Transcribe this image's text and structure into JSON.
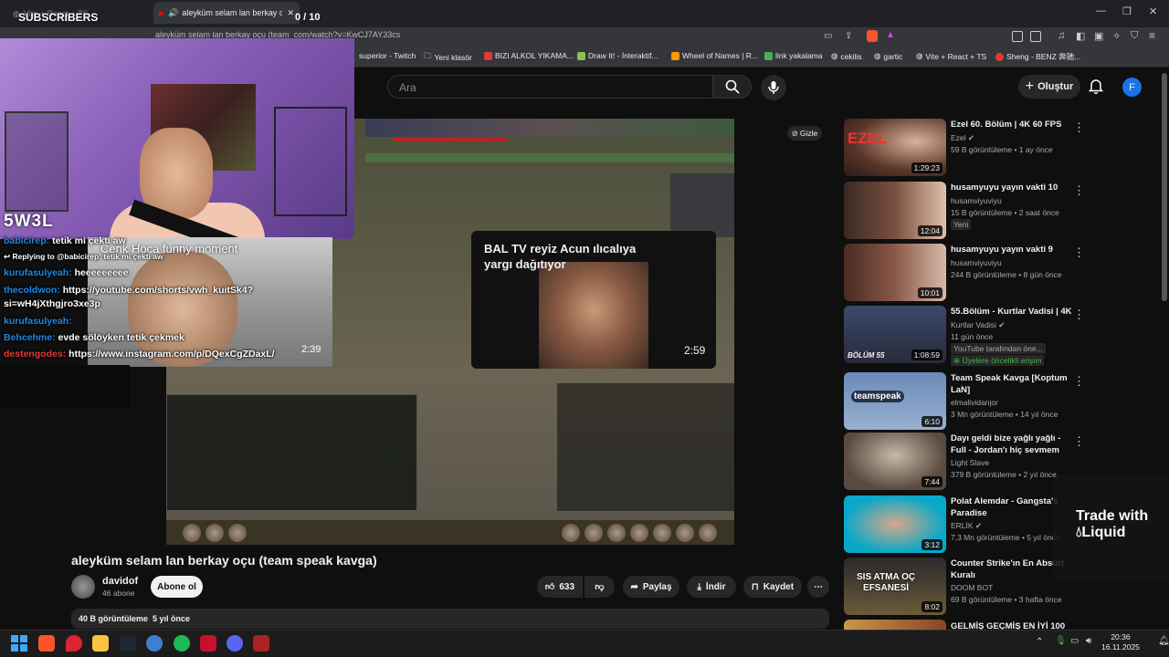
{
  "browser": {
    "tab1_title": "Vite + React + TS",
    "tab2_title": "aleyküm selam lan berkay oçu",
    "url_prefix": "aleyküm selam lan berkay oçu (team",
    "url": "com/watch?v=KwCJ7AY33cs",
    "bookmarks": [
      "superior - Twitch",
      "Yeni klasör",
      "BIZI ALKOL YIKAMA...",
      "Draw It! - İnteraktif...",
      "Wheel of Names | R...",
      "link yakalama",
      "cekilis",
      "gartic",
      "Vite + React + TS",
      "Sheng - BENZ 奔驰..."
    ]
  },
  "youtube": {
    "search_placeholder": "Ara",
    "create_label": "Oluştur",
    "avatar_letter": "F",
    "hide_label": "Gizle"
  },
  "overlay": {
    "subscribers_label": "SUBSCRIBERS",
    "subscribers_count": "0 / 10",
    "sw3l": "5W3L",
    "short_title": "Cenk Hoca funny moment",
    "short_duration": "2:39",
    "chat": [
      {
        "user": "babicirep:",
        "text": " tetik mi çekti aw",
        "color": "u"
      },
      {
        "user": "Replying to @babicirep:",
        "text": " tetik mi çekti aw",
        "color": "small"
      },
      {
        "user": "kurufasulyeah:",
        "text": " heeeeeeeee",
        "color": "u"
      },
      {
        "user": "thecoldwon:",
        "text": " https://youtube.com/shorts/vwh_kuitSk4?",
        "color": "u"
      },
      {
        "user": "",
        "text": "si=wH4jXthgjro3xe3p",
        "color": "w"
      },
      {
        "user": "kurufasulyeah:",
        "text": " ",
        "color": "u"
      },
      {
        "user": "Behcehme:",
        "text": " evde sölöyken tetik çekmek",
        "color": "u"
      },
      {
        "user": "destengodes:",
        "text": " https://www.instagram.com/p/DQexCgZDaxL/",
        "color": "r"
      }
    ]
  },
  "endcard": {
    "title": "BAL TV reyiz Acun ılıcalıya yargı dağıtıyor",
    "duration": "2:59"
  },
  "video": {
    "title": "aleyküm selam lan berkay oçu (team speak kavga)",
    "channel": "davidof",
    "subs": "46 abone",
    "subscribe": "Abone ol",
    "likes": "633",
    "share": "Paylaş",
    "download": "İndir",
    "save": "Kaydet",
    "views_date": "40 B görüntüleme  5 yıl önce"
  },
  "related": [
    {
      "title": "Ezel 60. Bölüm | 4K 60 FPS",
      "channel": "Ezel",
      "meta": "59 B görüntüleme • 1 ay önce",
      "duration": "1:29:23",
      "badge": ""
    },
    {
      "title": "husamyuyu yayın vakti 10",
      "channel": "husamviyuviyu",
      "meta": "15 B görüntüleme • 2 saat önce",
      "duration": "12:04",
      "badge": "Yeni"
    },
    {
      "title": "husamyuyu yayın vakti 9",
      "channel": "husamviyuviyu",
      "meta": "244 B görüntüleme • 8 gün önce",
      "duration": "10:01",
      "badge": ""
    },
    {
      "title": "55.Bölüm - Kurtlar Vadisi | 4K",
      "channel": "Kurtlar Vadisi",
      "meta": "11 gün önce",
      "duration": "1:08:59",
      "badge": "YouTube tarafından öne...",
      "badge2": "Üyelere öncelikli erişim"
    },
    {
      "title": "Team Speak Kavga [Koptum LaN]",
      "channel": "elmalividanjor",
      "meta": "3 Mn görüntüleme • 14 yıl önce",
      "duration": "6:10",
      "badge": ""
    },
    {
      "title": "Dayı geldi bize yağlı yağlı - Full - Jordan'ı hiç sevmem",
      "channel": "Light Slave",
      "meta": "379 B görüntüleme • 2 yıl önce",
      "duration": "7:44",
      "badge": ""
    },
    {
      "title": "Polat Alemdar - Gangsta's Paradise",
      "channel": "ERLİK",
      "meta": "7,3 Mn görüntüleme • 5 yıl önce",
      "duration": "3:12",
      "badge": ""
    },
    {
      "title": "Counter Strike'ın En Absürt Kuralı",
      "channel": "DOOM BOT",
      "meta": "69 B görüntüleme • 3 hafta önce",
      "duration": "8:02",
      "badge": ""
    },
    {
      "title": "GELMİŞ GEÇMİŞ EN İYİ 100",
      "channel": "",
      "meta": "",
      "duration": "",
      "badge": ""
    }
  ],
  "ad": {
    "line1": "Trade with",
    "line2": "Liquid"
  },
  "taskbar": {
    "time": "20:36",
    "date": "16.11.2025"
  },
  "colors": {
    "accent": "#1a73e8",
    "youtube_red": "#ff0000",
    "chat_user": "#1e88e5",
    "chat_user_red": "#e53935"
  }
}
